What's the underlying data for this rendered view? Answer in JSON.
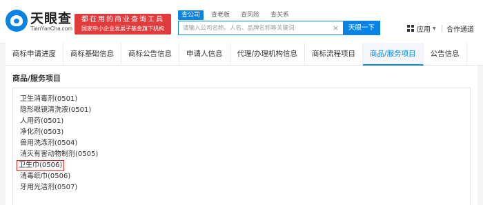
{
  "brand": {
    "name_cn": "天眼查",
    "name_en": "TianYanCha.com",
    "slogan_line1": "都在用的商业查询工具",
    "slogan_line2": "国家中小企业发展子基金旗下机构"
  },
  "search": {
    "tabs": [
      "查公司",
      "查老板",
      "查风险",
      "查关系"
    ],
    "active_tab": "查公司",
    "placeholder": "请输入公司名称、人名、品牌名称等关键词",
    "clear_icon": "×",
    "button_label": "天眼一下"
  },
  "header_right": {
    "apps_label": "应用",
    "partner_label": "合作通道"
  },
  "tabs": [
    "商标申请进度",
    "商标基础信息",
    "商标公告信息",
    "申请人信息",
    "代理/办理机构信息",
    "商标流程项目",
    "商品/服务项目",
    "公告信息"
  ],
  "active_tab_index": 6,
  "section_title": "商品/服务项目",
  "items": [
    "卫生消毒剂(0501)",
    "隐形眼镜清洗液(0501)",
    "人用药(0501)",
    "净化剂(0503)",
    "兽用洗涤剂(0504)",
    "消灭有害动物制剂(0505)",
    "卫生巾(0506)",
    "消毒纸巾(0506)",
    "牙用光洁剂(0507)"
  ],
  "highlighted_item_index": 6,
  "colors": {
    "accent": "#0a84e4",
    "slogan_bg": "#e23b3b",
    "highlight_border": "#e02020"
  }
}
